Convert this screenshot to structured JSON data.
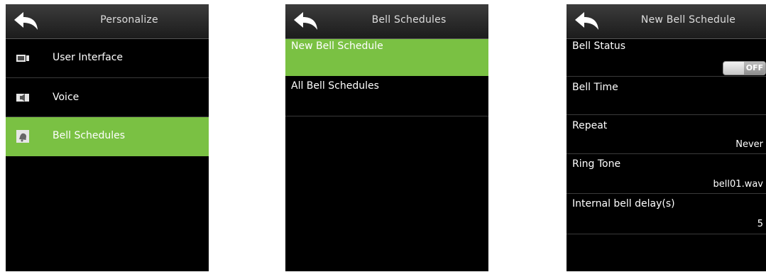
{
  "screens": [
    {
      "title": "Personalize",
      "items": [
        {
          "label": "User Interface",
          "icon": "monitor-icon"
        },
        {
          "label": "Voice",
          "icon": "speaker-icon"
        },
        {
          "label": "Bell Schedules",
          "icon": "bell-icon",
          "selected": true
        }
      ]
    },
    {
      "title": "Bell Schedules",
      "items": [
        {
          "label": "New Bell Schedule",
          "selected": true
        },
        {
          "label": "All Bell Schedules"
        }
      ]
    },
    {
      "title": "New Bell Schedule",
      "items": [
        {
          "label": "Bell Status",
          "toggle": "OFF"
        },
        {
          "label": "Bell Time",
          "value": ""
        },
        {
          "label": "Repeat",
          "value": "Never"
        },
        {
          "label": "Ring Tone",
          "value": "bell01.wav"
        },
        {
          "label": "Internal bell delay(s)",
          "value": "5"
        }
      ]
    }
  ],
  "colors": {
    "selected": "#7ac143",
    "background": "#000000",
    "header": "#2a2a2a"
  }
}
